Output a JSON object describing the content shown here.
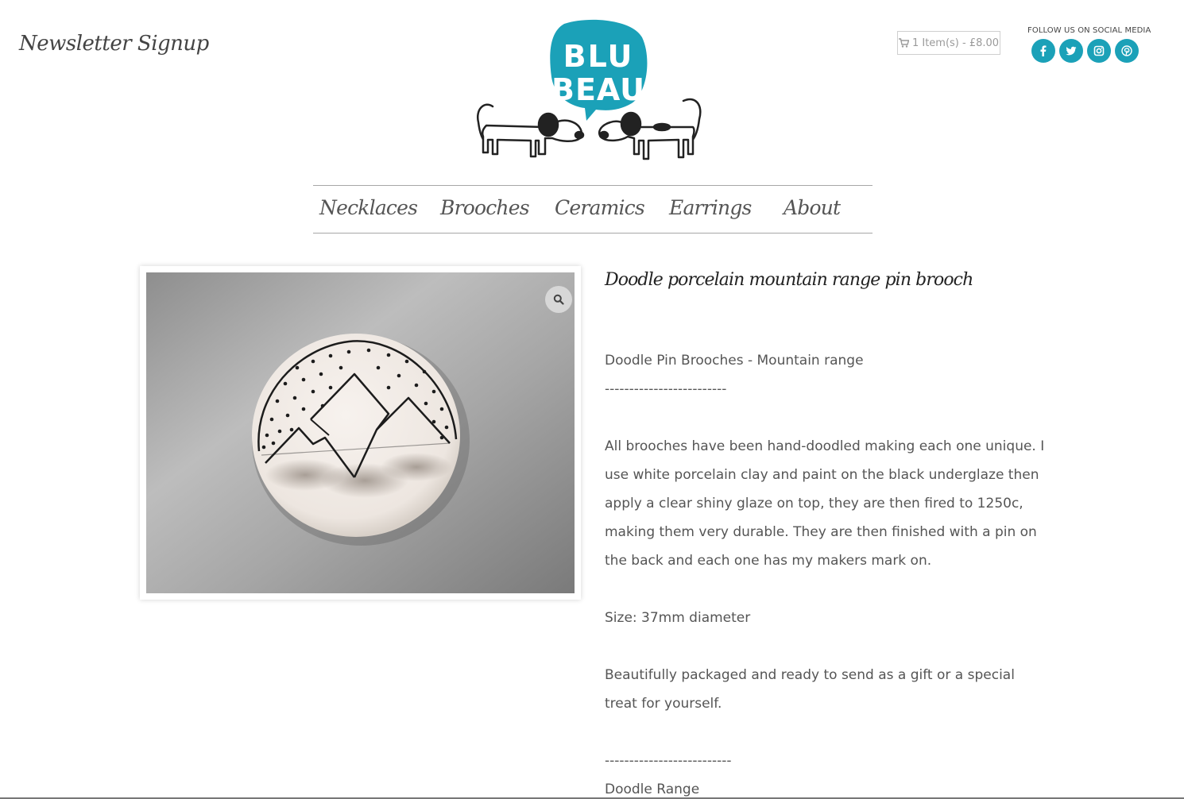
{
  "header": {
    "newsletter_label": "Newsletter Signup",
    "logo_text_line1": "BLU",
    "logo_text_line2": "BEAU",
    "cart_label": "1 Item(s) - £8.00",
    "social_title": "FOLLOW US ON SOCIAL MEDIA",
    "social_icons": [
      "facebook-icon",
      "twitter-icon",
      "instagram-icon",
      "pinterest-icon"
    ]
  },
  "nav": {
    "items": [
      {
        "label": "Necklaces"
      },
      {
        "label": "Brooches"
      },
      {
        "label": "Ceramics"
      },
      {
        "label": "Earrings"
      },
      {
        "label": "About"
      }
    ]
  },
  "product": {
    "title": "Doodle porcelain mountain range pin brooch",
    "subtitle": "Doodle Pin Brooches - Mountain range",
    "divider1": "-------------------------",
    "description": "All brooches have been hand-doodled making each one unique. I use white porcelain clay and paint on the black underglaze then apply a clear shiny glaze on top, they are then fired to 1250c, making them very durable. They are then finished with a pin on the back and each one has my makers mark on.",
    "size": "Size: 37mm diameter",
    "packaging": "Beautifully packaged and ready to send as a gift or a special treat for yourself.",
    "divider2": "--------------------------",
    "range_label": "Doodle Range"
  },
  "colors": {
    "brand_teal": "#1ba1b8",
    "text": "#555555"
  }
}
